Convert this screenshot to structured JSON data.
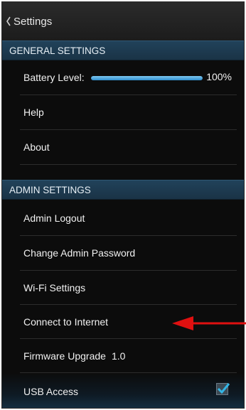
{
  "header": {
    "back_icon": "chevron-left-icon",
    "title": "Settings"
  },
  "general": {
    "title": "GENERAL SETTINGS",
    "battery": {
      "label": "Battery Level:",
      "value_text": "100%",
      "level": 1.0
    },
    "items": [
      {
        "label": "Help"
      },
      {
        "label": "About"
      }
    ]
  },
  "admin": {
    "title": "ADMIN SETTINGS",
    "items": [
      {
        "label": "Admin Logout"
      },
      {
        "label": "Change Admin Password"
      },
      {
        "label": "Wi-Fi Settings"
      },
      {
        "label": "Connect to Internet"
      }
    ],
    "firmware": {
      "label": "Firmware Upgrade",
      "version": "1.0"
    },
    "usb": {
      "label": "USB Access",
      "checked": true
    }
  },
  "annotation": {
    "arrow_color": "#e01010",
    "points_to": "Connect to Internet"
  },
  "colors": {
    "section_header": "#1e3c52",
    "accent": "#33b5e5"
  }
}
